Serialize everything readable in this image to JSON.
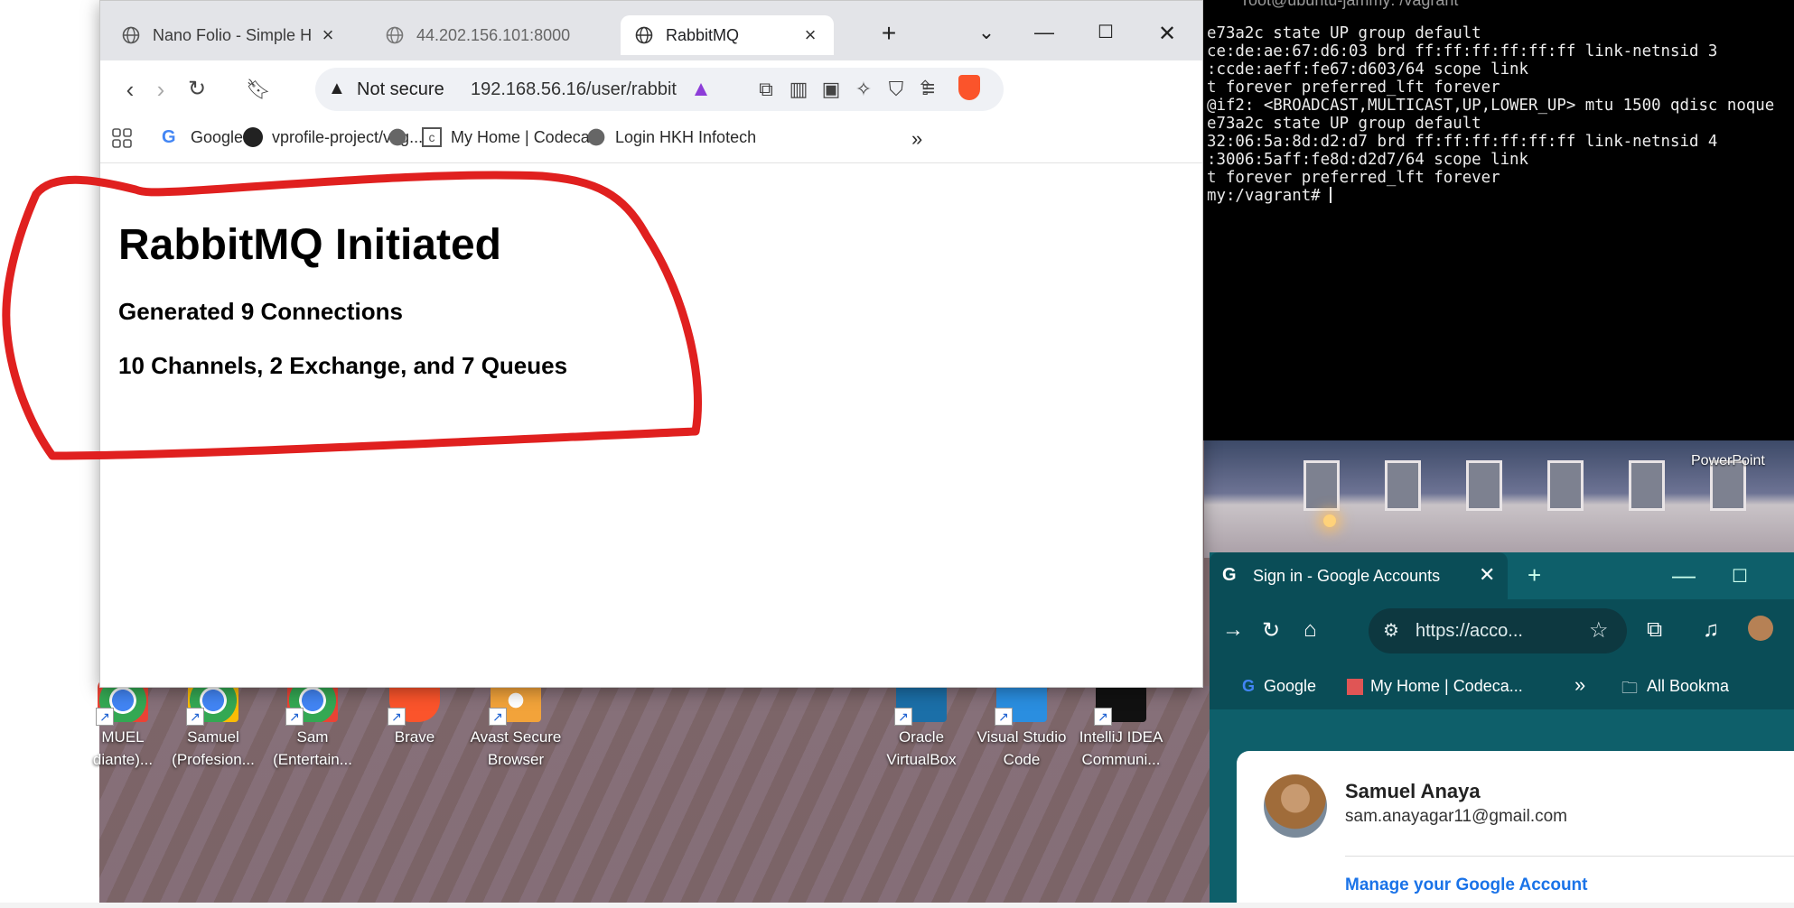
{
  "browser": {
    "tabs": [
      {
        "label": "Nano Folio - Simple H",
        "active": false
      },
      {
        "label": "44.202.156.101:8000",
        "active": false
      },
      {
        "label": "RabbitMQ",
        "active": true
      }
    ],
    "new_tab_label": "+",
    "address": {
      "security_label": "Not secure",
      "url": "192.168.56.16/user/rabbit"
    },
    "bookmarks": [
      "Google",
      "vprofile-project/vag...",
      "My Home | Codeca...",
      "Login HKH Infotech"
    ],
    "more_bookmarks": "»"
  },
  "page": {
    "title": "RabbitMQ Initiated",
    "connections": "Generated 9 Connections",
    "summary": "10 Channels, 2 Exchange, and 7 Queues"
  },
  "terminal": {
    "title": "root@ubuntu-jammy: /vagrant",
    "lines": [
      "e73a2c state UP group default",
      "ce:de:ae:67:d6:03 brd ff:ff:ff:ff:ff:ff link-netnsid 3",
      ":ccde:aeff:fe67:d603/64 scope link",
      "t forever preferred_lft forever",
      "@if2: <BROADCAST,MULTICAST,UP,LOWER_UP> mtu 1500 qdisc noque",
      "e73a2c state UP group default",
      "32:06:5a:8d:d2:d7 brd ff:ff:ff:ff:ff:ff link-netnsid 4",
      ":3006:5aff:fe8d:d2d7/64 scope link",
      "t forever preferred_lft forever",
      "my:/vagrant# "
    ]
  },
  "desktop": {
    "wallpaper_label": "PowerPoint",
    "icons": [
      {
        "label": "MUEL\ndiante)...",
        "color": "#34a853"
      },
      {
        "label": "Samuel\n(Profesion...",
        "color": "#34a853"
      },
      {
        "label": "Sam\n(Entertain...",
        "color": "#34a853"
      },
      {
        "label": "Brave",
        "color": "#fb542b"
      },
      {
        "label": "Avast Secure\nBrowser",
        "color": "#f2a33a"
      },
      {
        "label": "Oracle\nVirtualBox",
        "color": "#1b6fa8"
      },
      {
        "label": "Visual Studio\nCode",
        "color": "#2a8ee0"
      },
      {
        "label": "IntelliJ IDEA\nCommuni...",
        "color": "#111111"
      }
    ]
  },
  "google_browser": {
    "tab_title": "Sign in - Google Accounts",
    "url": "https://acco...",
    "bookmarks": [
      "Google",
      "My Home | Codeca...",
      "»",
      "All Bookma"
    ],
    "account": {
      "name": "Samuel Anaya",
      "email": "sam.anayagar11@gmail.com",
      "manage_label": "Manage your Google Account"
    }
  },
  "colors": {
    "annotation": "#e0201f",
    "link": "#1a73e8",
    "google_teal": "#0e5f6a"
  }
}
